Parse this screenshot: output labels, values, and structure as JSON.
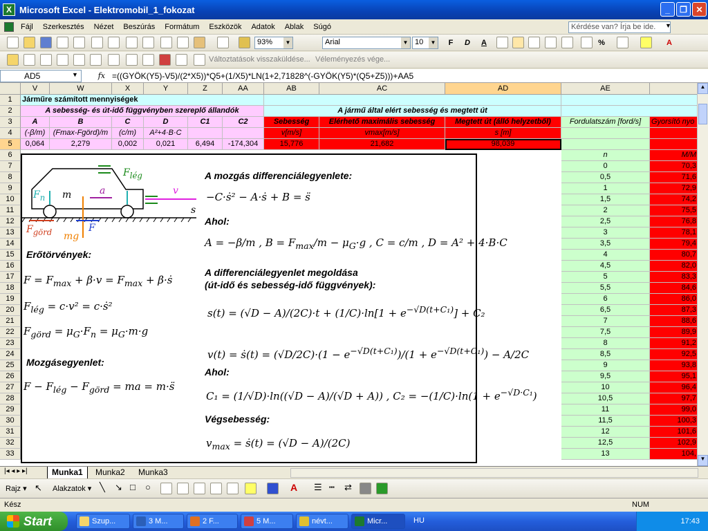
{
  "window": {
    "title": "Microsoft Excel - Elektromobil_1_fokozat"
  },
  "menu": {
    "items": [
      "Fájl",
      "Szerkesztés",
      "Nézet",
      "Beszúrás",
      "Formátum",
      "Eszközök",
      "Adatok",
      "Ablak",
      "Súgó"
    ],
    "help_placeholder": "Kérdése van? Írja be ide."
  },
  "toolbar": {
    "zoom": "93%",
    "font_name": "Arial",
    "font_size": "10",
    "bold": "F",
    "italic": "D",
    "underline": "A",
    "percent": "%",
    "review_reply": "Változtatások visszaküldése...",
    "review_end": "Véleményezés vége..."
  },
  "formula_bar": {
    "name_box": "AD5",
    "fx": "fx",
    "formula": "=((GYÖK(Y5)-V5)/(2*X5))*Q5+(1/X5)*LN(1+2,71828^(-GYÖK(Y5)*(Q5+Z5)))+AA5"
  },
  "columns": [
    "V",
    "W",
    "X",
    "Y",
    "Z",
    "AA",
    "AB",
    "AC",
    "AD",
    "AE"
  ],
  "rows": [
    "1",
    "2",
    "3",
    "4",
    "5",
    "6",
    "7",
    "8",
    "9",
    "10",
    "11",
    "12",
    "13",
    "14",
    "15",
    "16",
    "17",
    "18",
    "19",
    "20",
    "21",
    "22",
    "23",
    "24",
    "25",
    "26",
    "27",
    "28",
    "29",
    "30",
    "31",
    "32",
    "33"
  ],
  "sheet": {
    "r1": "Járműre számított mennyiségek",
    "r2_left": "A sebesség- és út-idő függvényben szereplő állandók",
    "r2_right": "A jármű által elért sebesség és megtett út",
    "r3": [
      "A",
      "B",
      "C",
      "D",
      "C1",
      "C2",
      "Sebesség",
      "Elérhető maximális sebesség",
      "Megtett út (álló helyzetből)",
      "Fordulatszám [ford/s]",
      "Gyorsító nyo"
    ],
    "r4": [
      "(-β/m)",
      "(Fmax-Fgörd)/m",
      "(c/m)",
      "A²+4·B·C",
      "",
      "",
      "v[m/s]",
      "vmax[m/s]",
      "s [m]"
    ],
    "r5": [
      "0,064",
      "2,279",
      "0,002",
      "0,021",
      "6,494",
      "-174,304",
      "15,776",
      "21,682",
      "98,039"
    ],
    "ae": [
      "n",
      "0",
      "0,5",
      "1",
      "1,5",
      "2",
      "2,5",
      "3",
      "3,5",
      "4",
      "4,5",
      "5",
      "5,5",
      "6",
      "6,5",
      "7",
      "7,5",
      "8",
      "8,5",
      "9",
      "9,5",
      "10",
      "10,5",
      "11",
      "11,5",
      "12",
      "12,5",
      "13"
    ],
    "af": [
      "M/M",
      "70,3",
      "71,6",
      "72,9",
      "74,2",
      "75,5",
      "76,8",
      "78,1",
      "79,4",
      "80,7",
      "82,0",
      "83,3",
      "84,6",
      "86,0",
      "87,3",
      "88,6",
      "89,9",
      "91,2",
      "92,5",
      "93,8",
      "95,1",
      "96,4",
      "97,7",
      "99,0",
      "100,3",
      "101,6",
      "102,9",
      "104,"
    ]
  },
  "panel": {
    "h_mozgas": "A mozgás differenciálegyenlete:",
    "h_ahol1": "Ahol:",
    "h_megoldas1": "A differenciálegyenlet megoldása",
    "h_megoldas2": "(út-idő és sebesség-idő függvények):",
    "h_ahol2": "Ahol:",
    "h_vegseb": "Végsebesség:",
    "h_erotorv": "Erőtörvények:",
    "h_mozgasegy": "Mozgásegyenlet:",
    "lbl_flég": "F",
    "lbl_m": "m",
    "lbl_a": "a",
    "lbl_v": "v",
    "lbl_s": "s",
    "lbl_mg": "mg",
    "lbl_F": "F"
  },
  "tabs": [
    "Munka1",
    "Munka2",
    "Munka3"
  ],
  "drawing": {
    "rajz": "Rajz",
    "alakzatok": "Alakzatok"
  },
  "status": {
    "left": "Kész",
    "num": "NUM"
  },
  "taskbar": {
    "start": "Start",
    "tasks": [
      "Szup...",
      "3 M...",
      "2 F...",
      "5 M...",
      "névt...",
      "Micr..."
    ],
    "lang": "HU",
    "clock": "17:43"
  }
}
